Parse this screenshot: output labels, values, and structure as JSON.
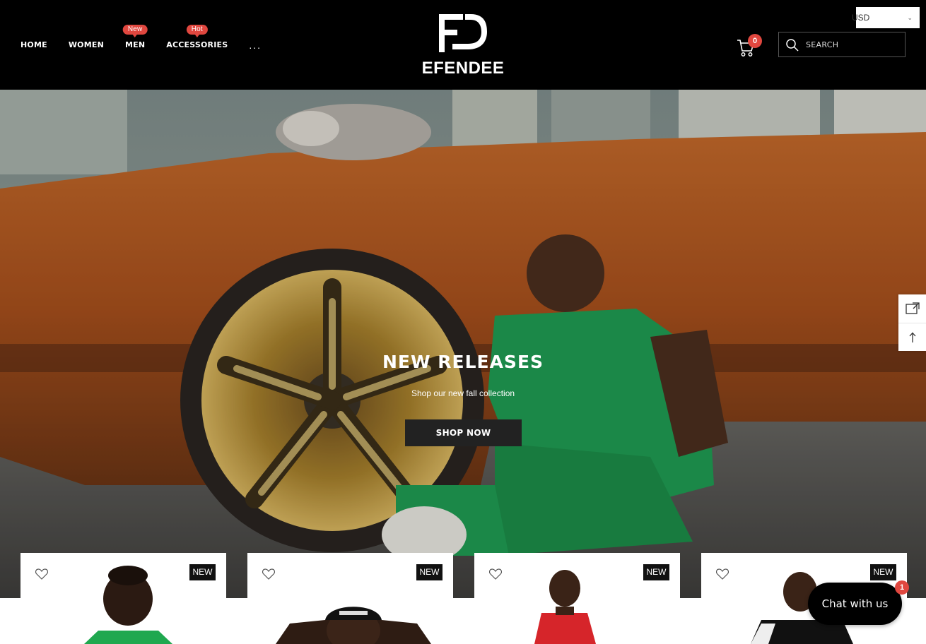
{
  "nav": {
    "items": [
      {
        "label": "HOME",
        "badge": null
      },
      {
        "label": "WOMEN",
        "badge": null
      },
      {
        "label": "MEN",
        "badge": "New"
      },
      {
        "label": "ACCESSORIES",
        "badge": "Hot"
      }
    ],
    "more": "..."
  },
  "brand": {
    "name": "EFENDEE"
  },
  "currency": {
    "selected": "USD"
  },
  "cart": {
    "count": "0"
  },
  "search": {
    "placeholder": "SEARCH"
  },
  "hero": {
    "title": "NEW RELEASES",
    "subtitle": "Shop our new fall collection",
    "button": "SHOP NOW"
  },
  "products": [
    {
      "badge": "NEW"
    },
    {
      "badge": "NEW"
    },
    {
      "badge": "NEW"
    },
    {
      "badge": "NEW"
    }
  ],
  "chat": {
    "label": "Chat with us",
    "badge": "1"
  },
  "colors": {
    "accent": "#e0473f",
    "header_bg": "#000000",
    "button_bg": "#222222"
  }
}
